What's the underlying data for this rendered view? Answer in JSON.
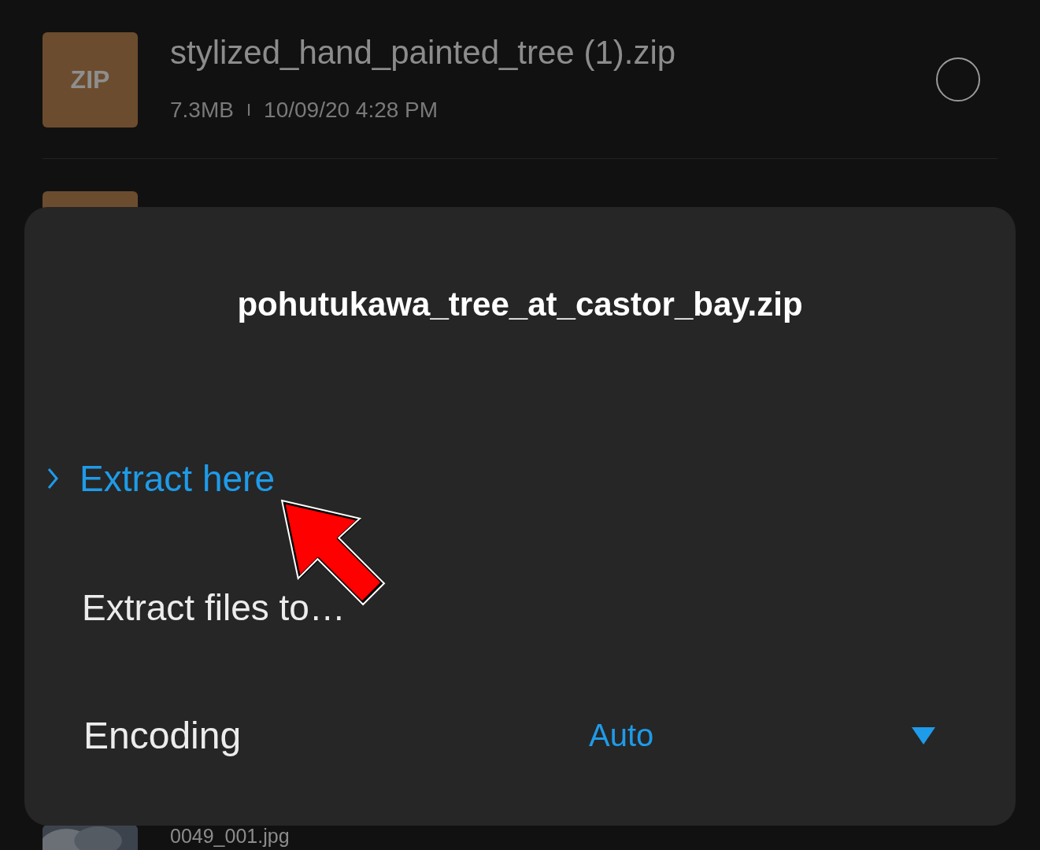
{
  "files": [
    {
      "kind": "zip",
      "icon_label": "ZIP",
      "name": "stylized_hand_painted_tree (1).zip",
      "size": "7.3MB",
      "separator": "I",
      "date": "10/09/20 4:28 PM",
      "selected": false
    },
    {
      "kind": "zip"
    },
    {
      "name": "0049_001.jpg"
    }
  ],
  "dialog": {
    "title": "pohutukawa_tree_at_castor_bay.zip",
    "options": [
      {
        "label": "Extract here",
        "selected": true
      },
      {
        "label": "Extract files to…",
        "selected": false
      }
    ],
    "encoding": {
      "label": "Encoding",
      "value": "Auto"
    }
  }
}
